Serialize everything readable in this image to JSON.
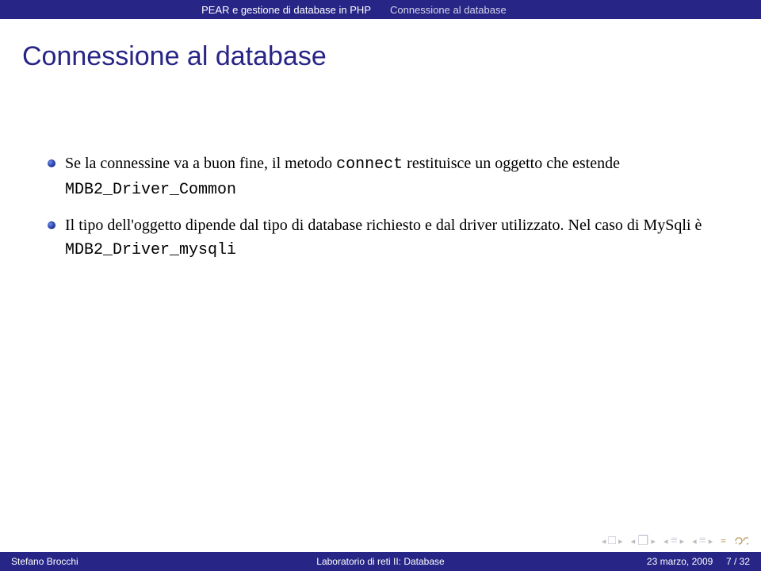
{
  "header": {
    "left": "PEAR e gestione di database in PHP",
    "right": "Connessione al database"
  },
  "title": "Connessione al database",
  "bullets": [
    {
      "pre": "Se la connessine va a buon fine, il metodo ",
      "code": "connect",
      "mid": " restituisce un oggetto che estende ",
      "code2": "MDB2_Driver_Common",
      "post": ""
    },
    {
      "pre": "Il tipo dell'oggetto dipende dal tipo di database richiesto e dal driver utilizzato. Nel caso di MySqli è ",
      "code": "MDB2_Driver_mysqli",
      "mid": "",
      "code2": "",
      "post": ""
    }
  ],
  "nav_icons": {
    "slide": "□",
    "frame": "❐",
    "section_l": "≡",
    "section_r": "≡",
    "summary": "≡"
  },
  "footer": {
    "author": "Stefano Brocchi",
    "course": "Laboratorio di reti II: Database",
    "date": "23 marzo, 2009",
    "page": "7 / 32"
  }
}
